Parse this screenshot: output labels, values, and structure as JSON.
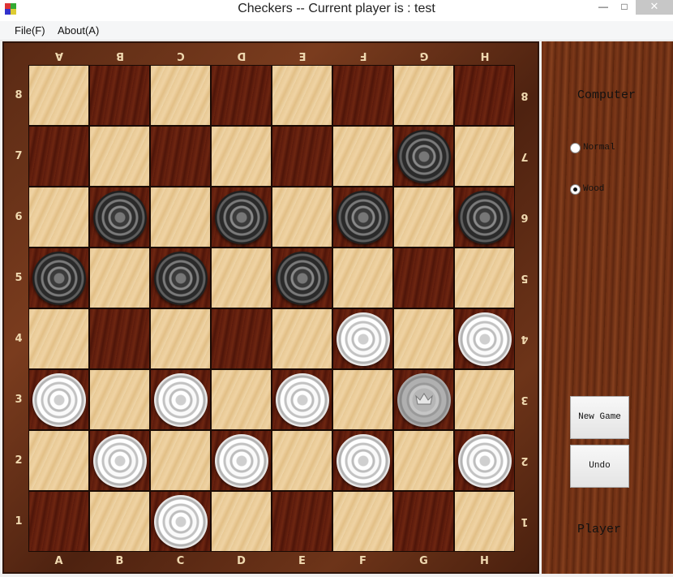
{
  "window": {
    "title": "Checkers -- Current player is : test",
    "minimize_label": "—",
    "maximize_label": "□",
    "close_label": "✕"
  },
  "menu": {
    "items": [
      {
        "label": "File(F)"
      },
      {
        "label": "About(A)"
      }
    ]
  },
  "board": {
    "files": [
      "A",
      "B",
      "C",
      "D",
      "E",
      "F",
      "G",
      "H"
    ],
    "ranks": [
      "8",
      "7",
      "6",
      "5",
      "4",
      "3",
      "2",
      "1"
    ],
    "squares_dark_on": "odd-sum",
    "pieces": [
      {
        "square": "G7",
        "color": "black",
        "king": false
      },
      {
        "square": "B6",
        "color": "black",
        "king": false
      },
      {
        "square": "D6",
        "color": "black",
        "king": false
      },
      {
        "square": "F6",
        "color": "black",
        "king": false
      },
      {
        "square": "H6",
        "color": "black",
        "king": false
      },
      {
        "square": "A5",
        "color": "black",
        "king": false
      },
      {
        "square": "C5",
        "color": "black",
        "king": false
      },
      {
        "square": "E5",
        "color": "black",
        "king": false
      },
      {
        "square": "F4",
        "color": "white",
        "king": false
      },
      {
        "square": "H4",
        "color": "white",
        "king": false
      },
      {
        "square": "A3",
        "color": "white",
        "king": false
      },
      {
        "square": "C3",
        "color": "white",
        "king": false
      },
      {
        "square": "E3",
        "color": "white",
        "king": false
      },
      {
        "square": "G3",
        "color": "white",
        "king": true
      },
      {
        "square": "B2",
        "color": "white",
        "king": false
      },
      {
        "square": "D2",
        "color": "white",
        "king": false
      },
      {
        "square": "F2",
        "color": "white",
        "king": false
      },
      {
        "square": "H2",
        "color": "white",
        "king": false
      },
      {
        "square": "C1",
        "color": "white",
        "king": false
      }
    ]
  },
  "side_panel": {
    "computer_label": "Computer",
    "player_label": "Player",
    "style_options": [
      {
        "label": "Normal",
        "checked": false
      },
      {
        "label": "Wood",
        "checked": true
      }
    ],
    "new_game_label": "New Game",
    "undo_label": "Undo"
  }
}
